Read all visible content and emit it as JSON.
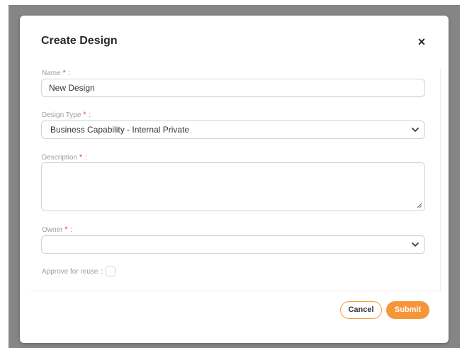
{
  "dialog": {
    "title": "Create Design",
    "close_symbol": "×"
  },
  "form": {
    "name": {
      "label": "Name",
      "required_mark": "*",
      "colon": ":",
      "value": "New Design"
    },
    "design_type": {
      "label": "Design Type",
      "required_mark": "*",
      "colon": ":",
      "value": "Business Capability - Internal Private"
    },
    "description": {
      "label": "Description",
      "required_mark": "*",
      "colon": ":",
      "value": ""
    },
    "owner": {
      "label": "Owner",
      "required_mark": "*",
      "colon": ":",
      "value": ""
    },
    "approve_for_reuse": {
      "label": "Approve for reuse",
      "colon": ":",
      "checked": false
    }
  },
  "actions": {
    "cancel_label": "Cancel",
    "submit_label": "Submit"
  },
  "colors": {
    "accent": "#f6963a",
    "required": "#e8473b",
    "backdrop": "#858585"
  }
}
